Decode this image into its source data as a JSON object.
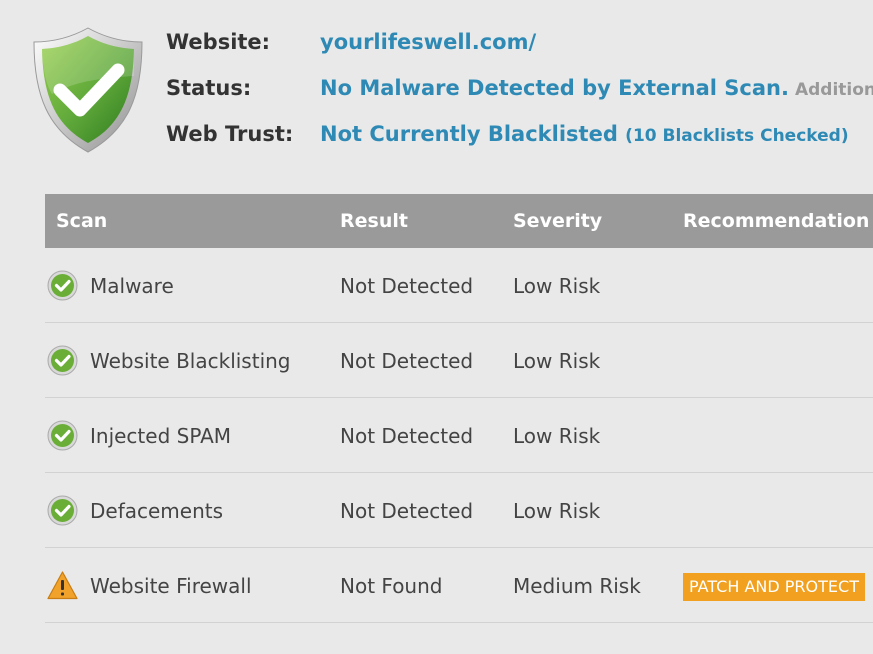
{
  "summary": {
    "website_label": "Website:",
    "website_value": "yourlifeswell.com/",
    "status_label": "Status:",
    "status_value": "No Malware Detected by External Scan.",
    "status_extra": "Additional A",
    "trust_label": "Web Trust:",
    "trust_value": "Not Currently Blacklisted",
    "trust_extra": "(10 Blacklists Checked)"
  },
  "table": {
    "headers": {
      "scan": "Scan",
      "result": "Result",
      "severity": "Severity",
      "recommendation": "Recommendation"
    },
    "rows": [
      {
        "icon": "check-circle-icon",
        "scan": "Malware",
        "result": "Not Detected",
        "severity": "Low Risk",
        "recommendation": ""
      },
      {
        "icon": "check-circle-icon",
        "scan": "Website Blacklisting",
        "result": "Not Detected",
        "severity": "Low Risk",
        "recommendation": ""
      },
      {
        "icon": "check-circle-icon",
        "scan": "Injected SPAM",
        "result": "Not Detected",
        "severity": "Low Risk",
        "recommendation": ""
      },
      {
        "icon": "check-circle-icon",
        "scan": "Defacements",
        "result": "Not Detected",
        "severity": "Low Risk",
        "recommendation": ""
      },
      {
        "icon": "warning-triangle-icon",
        "scan": "Website Firewall",
        "result": "Not Found",
        "severity": "Medium Risk",
        "recommendation": "PATCH AND PROTECT"
      }
    ]
  },
  "colors": {
    "accent_blue": "#2e8ab5",
    "header_grey": "#9a9a9a",
    "badge_orange": "#f1a020",
    "shield_green": "#5ea83a"
  },
  "icons": {
    "logo": "shield-check-icon"
  }
}
